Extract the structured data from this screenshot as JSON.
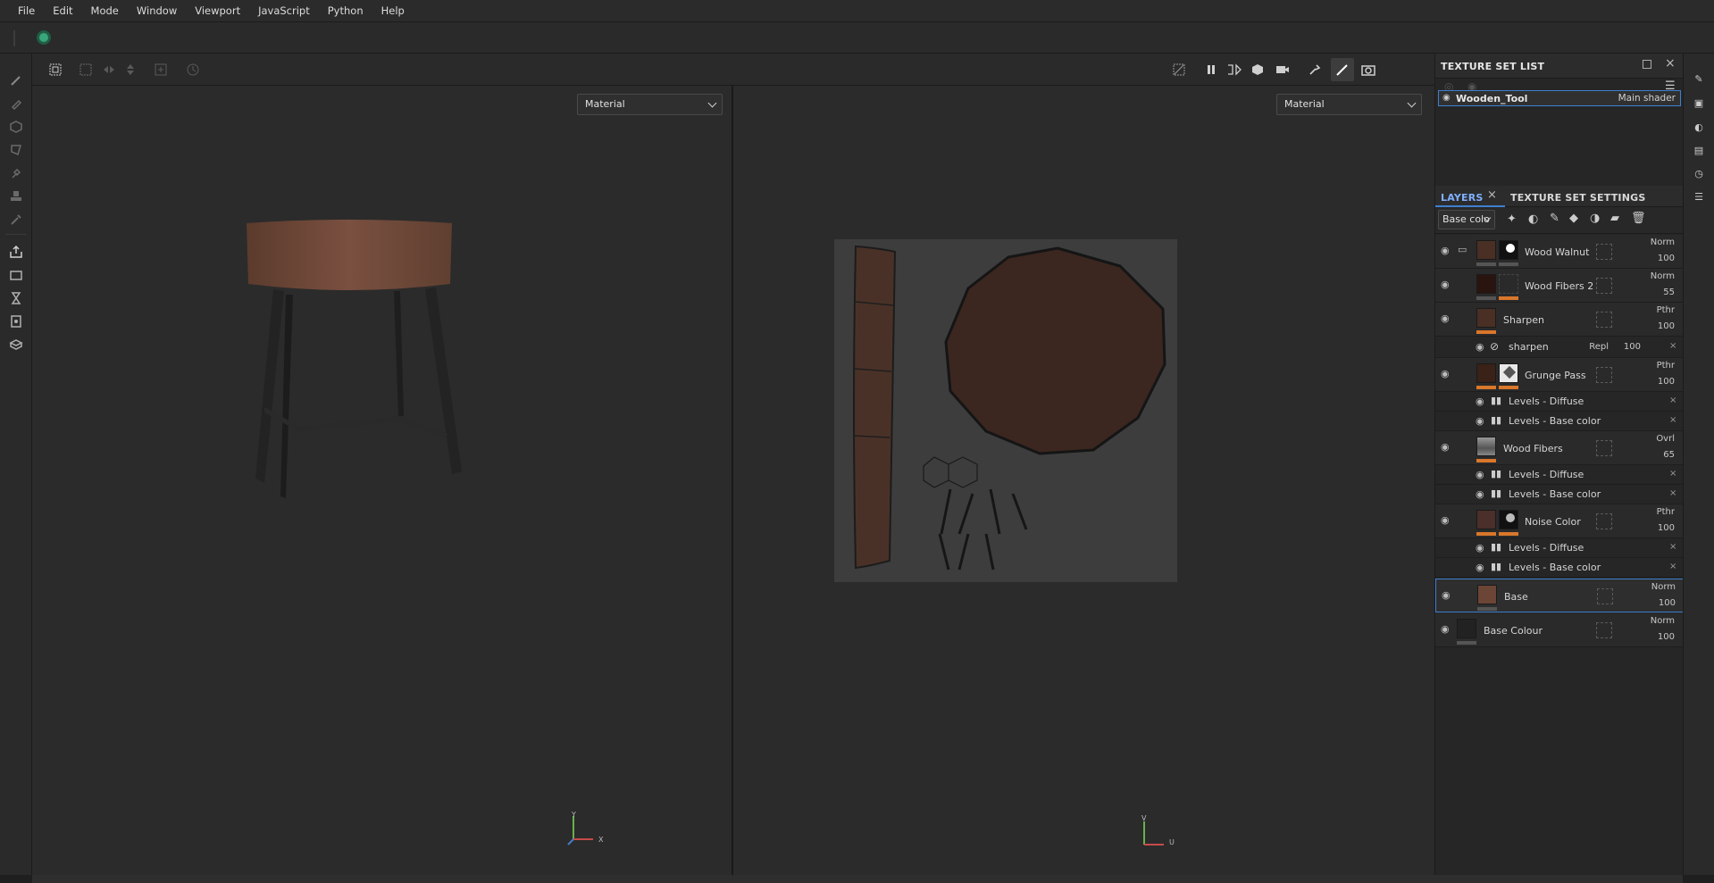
{
  "menu": [
    "File",
    "Edit",
    "Mode",
    "Window",
    "Viewport",
    "JavaScript",
    "Python",
    "Help"
  ],
  "viewport": {
    "left_dropdown": "Material",
    "right_dropdown": "Material",
    "axis_left": {
      "y": "Y",
      "x": "X"
    },
    "axis_right": {
      "v": "V",
      "u": "U"
    }
  },
  "texture_set_list": {
    "title": "TEXTURE SET LIST",
    "item_name": "Wooden_Tool",
    "item_shader": "Main shader"
  },
  "layers_panel": {
    "tab_layers": "LAYERS",
    "tab_settings": "TEXTURE SET SETTINGS",
    "channel_select": "Base colo",
    "layers": [
      {
        "name": "Wood Walnut",
        "blend": "Norm",
        "opacity": "100"
      },
      {
        "name": "Wood Fibers 2",
        "blend": "Norm",
        "opacity": "55"
      },
      {
        "name": "Sharpen",
        "blend": "Pthr",
        "opacity": "100"
      },
      {
        "name": "sharpen",
        "blend": "Repl",
        "opacity": "100"
      },
      {
        "name": "Grunge Pass",
        "blend": "Pthr",
        "opacity": "100"
      },
      {
        "name": "Levels - Diffuse"
      },
      {
        "name": "Levels - Base color"
      },
      {
        "name": "Wood Fibers",
        "blend": "Ovrl",
        "opacity": "65"
      },
      {
        "name": "Levels - Diffuse"
      },
      {
        "name": "Levels - Base color"
      },
      {
        "name": "Noise Color",
        "blend": "Pthr",
        "opacity": "100"
      },
      {
        "name": "Levels - Diffuse"
      },
      {
        "name": "Levels - Base color"
      },
      {
        "name": "Base",
        "blend": "Norm",
        "opacity": "100"
      },
      {
        "name": "Base Colour",
        "blend": "Norm",
        "opacity": "100"
      }
    ]
  },
  "colors": {
    "accent_orange": "#d9772b",
    "selection_blue": "#3f7fd0",
    "bg": "#2b2b2b"
  }
}
